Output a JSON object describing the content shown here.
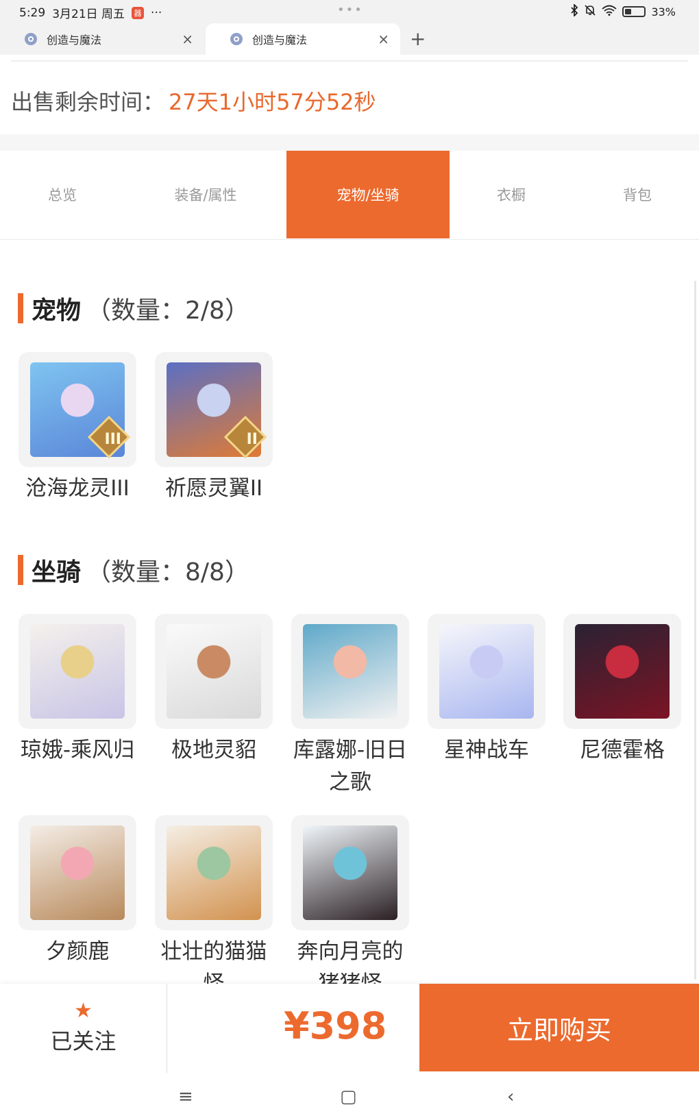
{
  "status_bar": {
    "time": "5:29",
    "date": "3月21日 周五",
    "app_badge": "器",
    "more": "···",
    "center_dots": "•••",
    "battery": "33%",
    "battery_level": 0.33
  },
  "browser_tabs": [
    {
      "title": "创造与魔法",
      "active": false
    },
    {
      "title": "创造与魔法",
      "active": true
    }
  ],
  "new_tab_label": "+",
  "close_label": "×",
  "sale": {
    "label": "出售剩余时间：",
    "value": "27天1小时57分52秒"
  },
  "content_tabs": [
    {
      "label": "总览",
      "active": false
    },
    {
      "label": "装备/属性",
      "active": false
    },
    {
      "label": "宠物/坐骑",
      "active": true
    },
    {
      "label": "衣橱",
      "active": false
    },
    {
      "label": "背包",
      "active": false
    }
  ],
  "pets": {
    "title": "宠物",
    "count": "（数量：2/8）",
    "items": [
      {
        "name": "沧海龙灵III",
        "rank": "III",
        "art": [
          "#7fc4f0",
          "#5a86d8",
          "#e9d7f2"
        ]
      },
      {
        "name": "祈愿灵翼II",
        "rank": "II",
        "art": [
          "#5b6fc4",
          "#e07b34",
          "#c9d2f0"
        ]
      }
    ]
  },
  "mounts": {
    "title": "坐骑",
    "count": "（数量：8/8）",
    "items": [
      {
        "name": "琼娥-乘风归",
        "art": [
          "#f4f1ec",
          "#c9c4e6",
          "#e8d08a"
        ]
      },
      {
        "name": "极地灵貂",
        "art": [
          "#fafafa",
          "#d9d9d9",
          "#c98a64"
        ]
      },
      {
        "name": "库露娜-旧日之歌",
        "art": [
          "#5fa9c9",
          "#f1f1f1",
          "#f2b9a7"
        ]
      },
      {
        "name": "星神战车",
        "art": [
          "#f6f6fa",
          "#a8b6f0",
          "#c8ccf5"
        ]
      },
      {
        "name": "尼德霍格",
        "art": [
          "#2a2233",
          "#7b1424",
          "#c72d3f"
        ]
      },
      {
        "name": "夕颜鹿",
        "art": [
          "#f4ede6",
          "#b88a5c",
          "#f3a7b3"
        ]
      },
      {
        "name": "壮壮的猫猫怪",
        "art": [
          "#f5eee4",
          "#d2924f",
          "#9cc7a0"
        ]
      },
      {
        "name": "奔向月亮的猪猪怪",
        "art": [
          "#f0f6fa",
          "#2b2024",
          "#6fc3d9"
        ]
      }
    ]
  },
  "bottom": {
    "follow_label": "已关注",
    "price": "¥398",
    "buy_label": "立即购买"
  },
  "nav": {
    "menu": "≡",
    "home": "▢",
    "back": "‹"
  },
  "colors": {
    "accent": "#ec6a2e",
    "sale_value": "#e8682d"
  }
}
